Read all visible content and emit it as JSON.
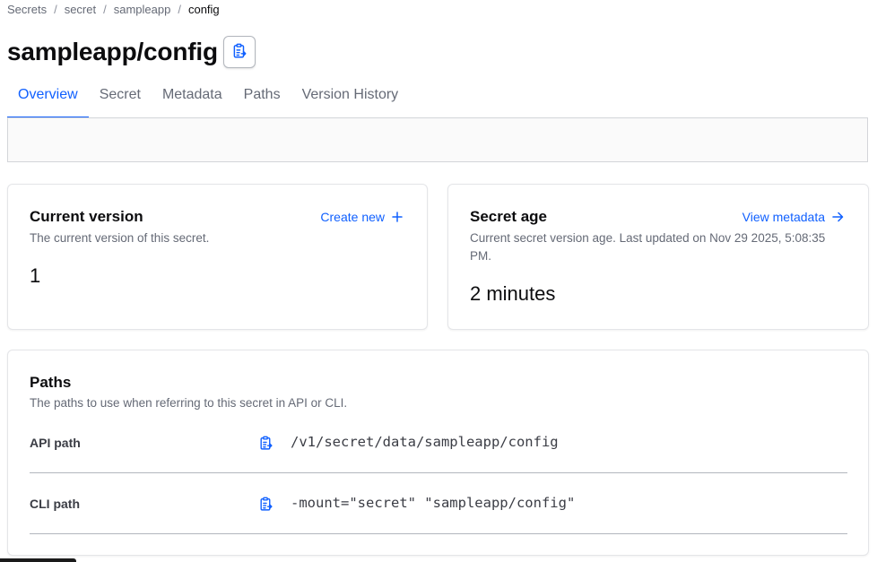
{
  "breadcrumb": {
    "items": [
      "Secrets",
      "secret",
      "sampleapp",
      "config"
    ],
    "separator": "/"
  },
  "page": {
    "title": "sampleapp/config",
    "copy_icon": "clipboard-copy-icon"
  },
  "tabs": [
    {
      "label": "Overview",
      "active": true
    },
    {
      "label": "Secret",
      "active": false
    },
    {
      "label": "Metadata",
      "active": false
    },
    {
      "label": "Paths",
      "active": false
    },
    {
      "label": "Version History",
      "active": false
    }
  ],
  "current_version": {
    "title": "Current version",
    "description": "The current version of this secret.",
    "value": "1",
    "action_label": "Create new",
    "action_icon": "plus-icon"
  },
  "secret_age": {
    "title": "Secret age",
    "description": "Current secret version age. Last updated on Nov 29 2025, 5:08:35 PM.",
    "value": "2 minutes",
    "action_label": "View metadata",
    "action_icon": "arrow-right-icon"
  },
  "paths": {
    "title": "Paths",
    "description": "The paths to use when referring to this secret in API or CLI.",
    "rows": [
      {
        "label": "API path",
        "value": "/v1/secret/data/sampleapp/config",
        "icon": "clipboard-copy-icon"
      },
      {
        "label": "CLI path",
        "value": "-mount=\"secret\" \"sampleapp/config\"",
        "icon": "clipboard-copy-icon"
      }
    ]
  },
  "colors": {
    "accent": "#1060ff",
    "text": "#0c0c0e",
    "muted": "#656a76",
    "border": "#d3d5d9"
  }
}
